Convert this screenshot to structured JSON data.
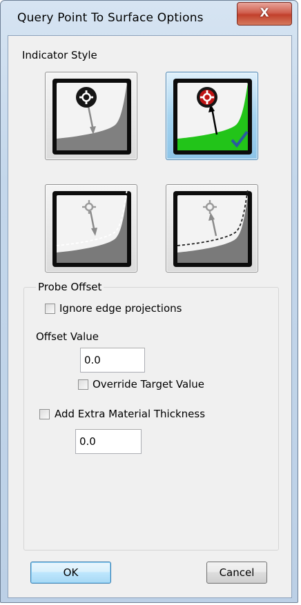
{
  "window": {
    "title": "Query Point To Surface Options",
    "close_glyph": "X"
  },
  "indicator_style": {
    "label": "Indicator Style",
    "options": [
      {
        "name": "solid-surface-arrow-down",
        "selected": false
      },
      {
        "name": "solid-surface-arrow-up",
        "selected": true
      },
      {
        "name": "dashed-surface-arrow-down",
        "selected": false
      },
      {
        "name": "dashed-surface-arrow-up",
        "selected": false
      }
    ]
  },
  "probe_offset": {
    "group_label": "Probe Offset",
    "ignore_edge_label": "Ignore edge projections",
    "ignore_edge_checked": false,
    "offset_value_label": "Offset Value",
    "offset_value": "0.0",
    "override_label": "Override Target Value",
    "override_checked": false,
    "extra_thickness_label": "Add Extra Material Thickness",
    "extra_thickness_checked": false,
    "extra_thickness_value": "0.0"
  },
  "buttons": {
    "ok": "OK",
    "cancel": "Cancel"
  },
  "colors": {
    "selected_surface": "#22c419",
    "marker_red": "#c01414",
    "checkmark": "#2a5aa0"
  }
}
